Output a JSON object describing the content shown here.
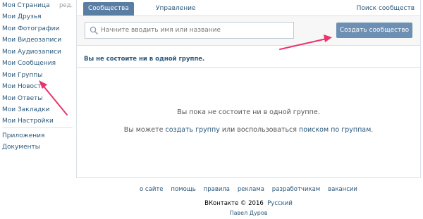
{
  "left_menu": {
    "edit_label": "ред.",
    "items": [
      {
        "label": "Моя Страница"
      },
      {
        "label": "Мои Друзья"
      },
      {
        "label": "Мои Фотографии"
      },
      {
        "label": "Мои Видеозаписи"
      },
      {
        "label": "Мои Аудиозаписи"
      },
      {
        "label": "Мои Сообщения"
      },
      {
        "label": "Мои Группы"
      },
      {
        "label": "Мои Новости"
      },
      {
        "label": "Мои Ответы"
      },
      {
        "label": "Мои Закладки"
      },
      {
        "label": "Мои Настройки"
      },
      {
        "label": "Приложения"
      },
      {
        "label": "Документы"
      }
    ]
  },
  "tabs": {
    "active": "Сообщества",
    "inactive": "Управление",
    "search_link": "Поиск сообществ"
  },
  "search": {
    "placeholder": "Начните вводить имя или название",
    "value": "",
    "icon": "search-icon"
  },
  "create_button": "Создать сообщество",
  "summary": "Вы не состоите ни в одной группе.",
  "empty_state": {
    "line1": "Вы пока не состоите ни в одной группе.",
    "line2_prefix": "Вы можете ",
    "create_link": "создать группу",
    "line2_middle": " или воспользоваться ",
    "search_link": "поиском по группам",
    "line2_suffix": "."
  },
  "footer": {
    "links": [
      "о сайте",
      "помощь",
      "правила",
      "реклама",
      "разработчикам",
      "вакансии"
    ],
    "copyright": "ВКонтакте © 2016",
    "language": "Русский",
    "author": "Павел Дуров"
  },
  "colors": {
    "link": "#2b587a",
    "tab_active_bg": "#597da3",
    "button_bg": "#6d8fb3",
    "annotation_arrow": "#e8356d"
  }
}
